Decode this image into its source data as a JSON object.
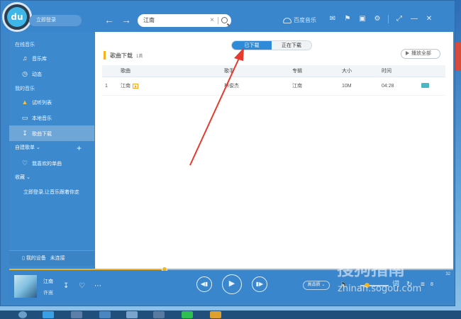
{
  "topbar": {
    "login_label": "立即登录",
    "search_value": "江南",
    "brand_label": "百度音乐"
  },
  "sidebar": {
    "sections": [
      {
        "title": "在线音乐",
        "items": [
          {
            "icon": "music-note-icon",
            "label": "音乐库"
          },
          {
            "icon": "clock-icon",
            "label": "动态"
          }
        ]
      },
      {
        "title": "我的音乐",
        "items": [
          {
            "icon": "speaker-icon",
            "label": "试听列表"
          },
          {
            "icon": "monitor-icon",
            "label": "本地音乐"
          },
          {
            "icon": "download-icon",
            "label": "歌曲下载"
          }
        ]
      }
    ],
    "playlist_group": "自建歌单",
    "favorite_item": "我喜欢的单曲",
    "collection_group": "收藏",
    "collection_hint": "立即登录,让音乐跟着你走",
    "device_label": "我的设备",
    "device_status": "未连接"
  },
  "main": {
    "tabs": [
      "已下载",
      "正在下载"
    ],
    "active_tab": 0,
    "title": "歌曲下载",
    "count": "1首",
    "play_all": "播放全部",
    "columns": [
      "",
      "歌曲",
      "歌手",
      "专辑",
      "大小",
      "时间",
      ""
    ],
    "rows": [
      {
        "index": "1",
        "song": "江南",
        "artist": "林俊杰",
        "album": "江南",
        "size": "10M",
        "time": "04:28"
      }
    ]
  },
  "player": {
    "song_title": "江南",
    "song_artist": "许嵩",
    "progress": 0.35,
    "quality": "高品质",
    "lyrics_label": "词",
    "count": "8",
    "time": "32"
  },
  "watermark": {
    "brand": "搜狗指南",
    "url": "zhinan.sogou.com"
  },
  "colors": {
    "accent": "#2f8ad7",
    "highlight": "#f2b21c",
    "arrow": "#e53a2d"
  }
}
